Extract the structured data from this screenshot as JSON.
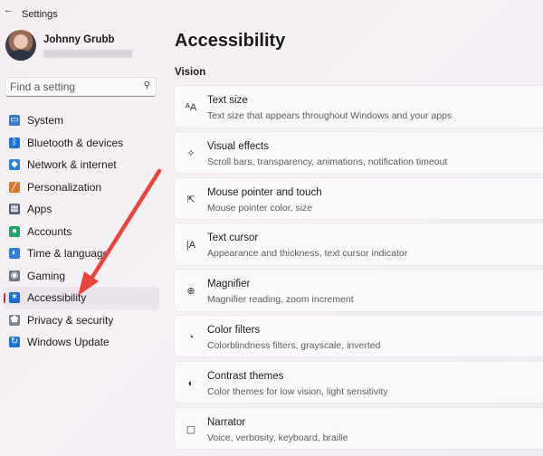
{
  "app": {
    "title": "Settings"
  },
  "profile": {
    "name": "Johnny Grubb"
  },
  "search": {
    "placeholder": "Find a setting"
  },
  "sidebar": {
    "items": [
      {
        "label": "System",
        "icon": "monitor-icon",
        "color": "#3a78c9"
      },
      {
        "label": "Bluetooth & devices",
        "icon": "bluetooth-icon",
        "color": "#1e74d6"
      },
      {
        "label": "Network & internet",
        "icon": "wifi-icon",
        "color": "#2a7fd8"
      },
      {
        "label": "Personalization",
        "icon": "brush-icon",
        "color": "#d57a2c"
      },
      {
        "label": "Apps",
        "icon": "apps-icon",
        "color": "#4b5a78"
      },
      {
        "label": "Accounts",
        "icon": "person-icon",
        "color": "#25a36b"
      },
      {
        "label": "Time & language",
        "icon": "globe-clock-icon",
        "color": "#2d7fd0"
      },
      {
        "label": "Gaming",
        "icon": "controller-icon",
        "color": "#6b7688"
      },
      {
        "label": "Accessibility",
        "icon": "accessibility-icon",
        "color": "#1a6fd1",
        "active": true
      },
      {
        "label": "Privacy & security",
        "icon": "shield-icon",
        "color": "#7a8493"
      },
      {
        "label": "Windows Update",
        "icon": "update-icon",
        "color": "#1f74d4"
      }
    ]
  },
  "main": {
    "title": "Accessibility",
    "section": "Vision",
    "cards": [
      {
        "title": "Text size",
        "description": "Text size that appears throughout Windows and your apps",
        "icon": "text-size-icon"
      },
      {
        "title": "Visual effects",
        "description": "Scroll bars, transparency, animations, notification timeout",
        "icon": "sparkle-icon"
      },
      {
        "title": "Mouse pointer and touch",
        "description": "Mouse pointer color, size",
        "icon": "pointer-icon"
      },
      {
        "title": "Text cursor",
        "description": "Appearance and thickness, text cursor indicator",
        "icon": "text-cursor-icon"
      },
      {
        "title": "Magnifier",
        "description": "Magnifier reading, zoom increment",
        "icon": "magnifier-icon"
      },
      {
        "title": "Color filters",
        "description": "Colorblindness filters, grayscale, inverted",
        "icon": "palette-icon"
      },
      {
        "title": "Contrast themes",
        "description": "Color themes for low vision, light sensitivity",
        "icon": "contrast-icon"
      },
      {
        "title": "Narrator",
        "description": "Voice, verbosity, keyboard, braille",
        "icon": "narrator-icon"
      }
    ]
  },
  "annotation": {
    "arrow_color": "#e8453c"
  }
}
